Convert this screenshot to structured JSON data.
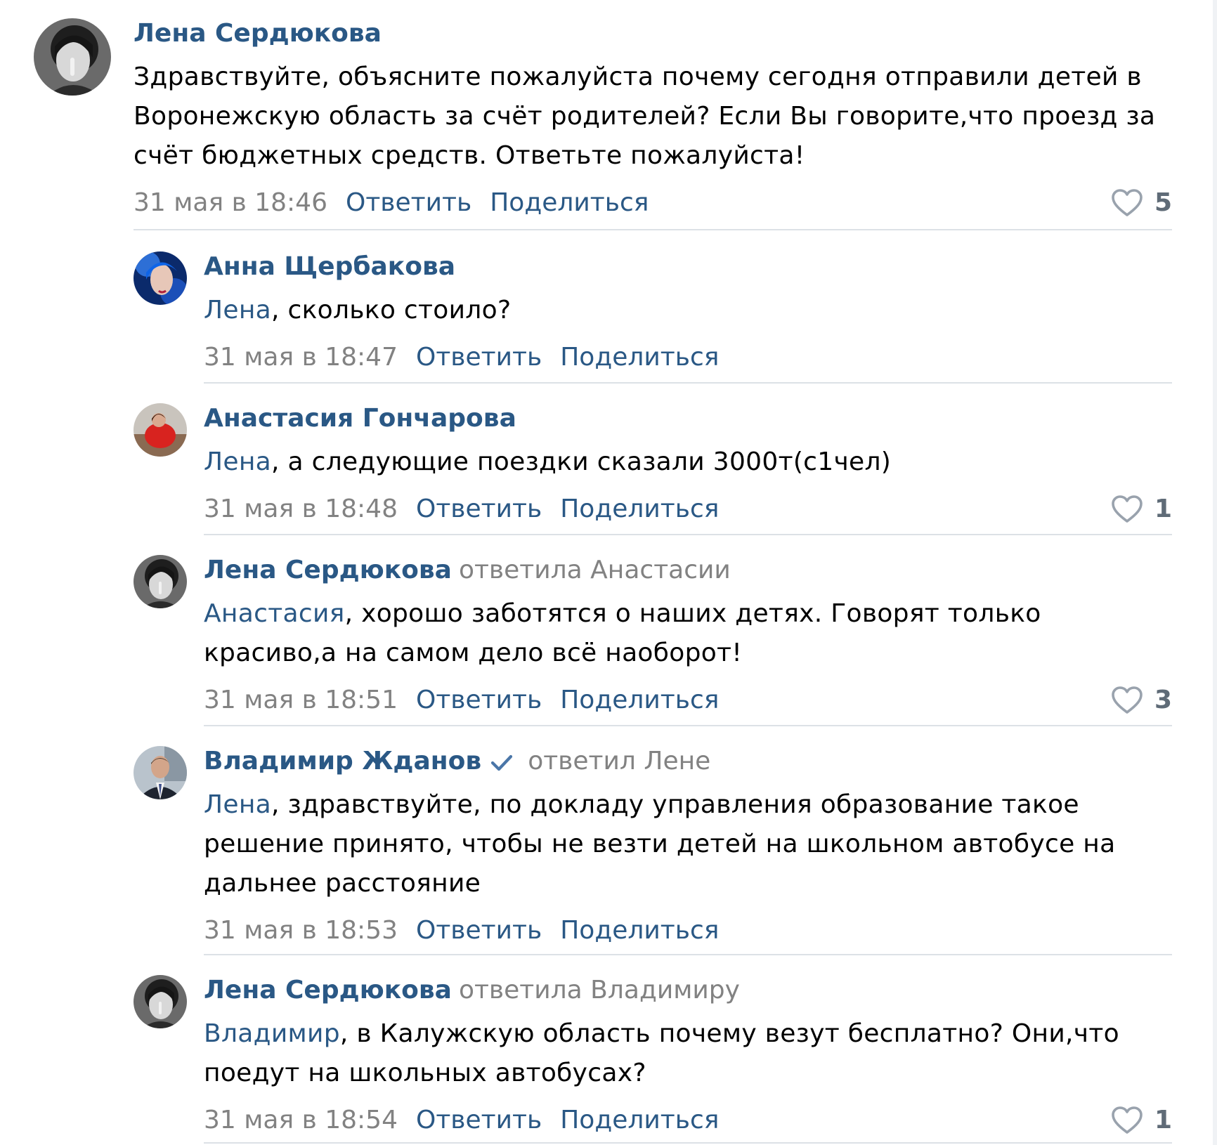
{
  "colors": {
    "link": "#2a5885",
    "muted": "#828282",
    "divider": "#dce1e6",
    "verified": "#4a76a8"
  },
  "comments": [
    {
      "author": "Лена Сердюкова",
      "reply_to": "",
      "verified": false,
      "mention": "",
      "text": "Здравствуйте, объясните пожалуйста почему сегодня отправили детей в Воронежскую область за счёт родителей? Если Вы говорите,что проезд за счёт бюджетных средств. Ответьте пожалуйста!",
      "date": "31 мая в 18:46",
      "reply_label": "Ответить",
      "share_label": "Поделиться",
      "likes": "5",
      "avatar_icon": "avatar-photo-bw"
    },
    {
      "author": "Анна Щербакова",
      "reply_to": "",
      "verified": false,
      "mention": "Лена",
      "text": ", сколько стоило?",
      "date": "31 мая в 18:47",
      "reply_label": "Ответить",
      "share_label": "Поделиться",
      "likes": "",
      "avatar_icon": "avatar-photo-blue"
    },
    {
      "author": "Анастасия Гончарова",
      "reply_to": "",
      "verified": false,
      "mention": "Лена",
      "text": ", а следующие поездки сказали 3000т(с1чел)",
      "date": "31 мая в 18:48",
      "reply_label": "Ответить",
      "share_label": "Поделиться",
      "likes": "1",
      "avatar_icon": "avatar-photo-red"
    },
    {
      "author": "Лена Сердюкова",
      "reply_to": "ответила Анастасии",
      "verified": false,
      "mention": "Анастасия",
      "text": ", хорошо заботятся о наших детях. Говорят только красиво,а на самом дело всё наоборот!",
      "date": "31 мая в 18:51",
      "reply_label": "Ответить",
      "share_label": "Поделиться",
      "likes": "3",
      "avatar_icon": "avatar-photo-bw"
    },
    {
      "author": "Владимир Жданов",
      "reply_to": "ответил Лене",
      "verified": true,
      "mention": "Лена",
      "text": ", здравствуйте, по докладу управления образование такое решение принято, чтобы не везти детей на школьном автобусе на дальнее расстояние",
      "date": "31 мая в 18:53",
      "reply_label": "Ответить",
      "share_label": "Поделиться",
      "likes": "",
      "avatar_icon": "avatar-photo-suit"
    },
    {
      "author": "Лена Сердюкова",
      "reply_to": "ответила Владимиру",
      "verified": false,
      "mention": "Владимир",
      "text": ", в Калужскую область почему везут бесплатно? Они,что поедут на школьных автобусах?",
      "date": "31 мая в 18:54",
      "reply_label": "Ответить",
      "share_label": "Поделиться",
      "likes": "1",
      "avatar_icon": "avatar-photo-bw"
    }
  ]
}
